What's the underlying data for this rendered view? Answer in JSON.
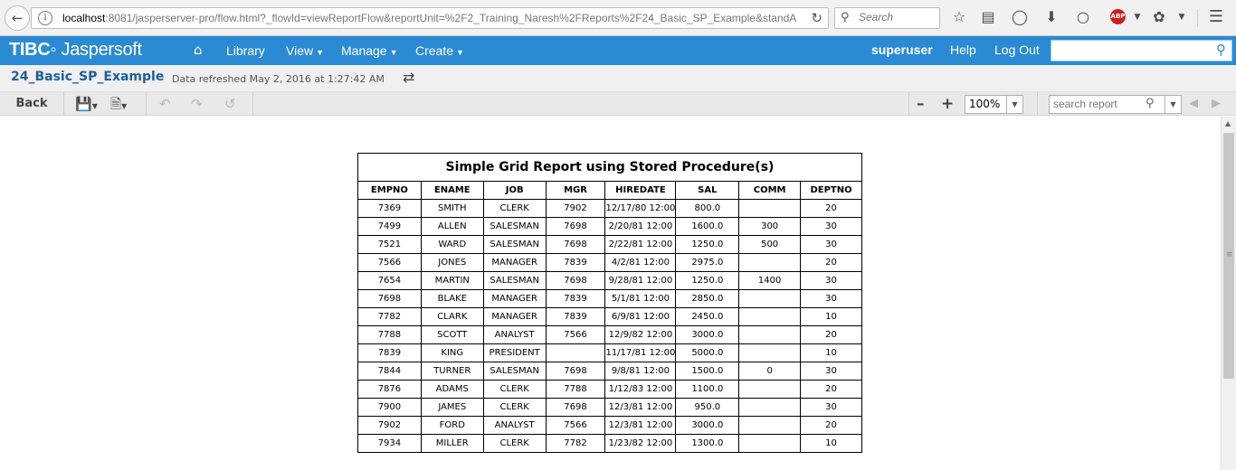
{
  "browser": {
    "url_host": "localhost",
    "url_rest": ":8081/jasperserver-pro/flow.html?_flowId=viewReportFlow&reportUnit=%2F2_Training_Naresh%2FReports%2F24_Basic_SP_Example&standA",
    "search_placeholder": "Search"
  },
  "header": {
    "logo_tibco": "TIBC",
    "logo_rest": "Jaspersoft",
    "menu": [
      {
        "label": "Library",
        "has_caret": false
      },
      {
        "label": "View",
        "has_caret": true
      },
      {
        "label": "Manage",
        "has_caret": true
      },
      {
        "label": "Create",
        "has_caret": true
      }
    ],
    "user": "superuser",
    "help": "Help",
    "logout": "Log Out",
    "search_value": ""
  },
  "title_bar": {
    "report_name": "24_Basic_SP_Example",
    "refreshed": "Data refreshed May 2, 2016 at 1:27:42 AM"
  },
  "toolbar": {
    "back": "Back",
    "zoom": "100%",
    "search_placeholder": "search report"
  },
  "report": {
    "title": "Simple Grid Report using Stored Procedure(s)",
    "columns": [
      "EMPNO",
      "ENAME",
      "JOB",
      "MGR",
      "HIREDATE",
      "SAL",
      "COMM",
      "DEPTNO"
    ],
    "rows": [
      [
        "7369",
        "SMITH",
        "CLERK",
        "7902",
        "12/17/80 12:00",
        "800.0",
        "",
        "20"
      ],
      [
        "7499",
        "ALLEN",
        "SALESMAN",
        "7698",
        "2/20/81 12:00",
        "1600.0",
        "300",
        "30"
      ],
      [
        "7521",
        "WARD",
        "SALESMAN",
        "7698",
        "2/22/81 12:00",
        "1250.0",
        "500",
        "30"
      ],
      [
        "7566",
        "JONES",
        "MANAGER",
        "7839",
        "4/2/81 12:00",
        "2975.0",
        "",
        "20"
      ],
      [
        "7654",
        "MARTIN",
        "SALESMAN",
        "7698",
        "9/28/81 12:00",
        "1250.0",
        "1400",
        "30"
      ],
      [
        "7698",
        "BLAKE",
        "MANAGER",
        "7839",
        "5/1/81 12:00",
        "2850.0",
        "",
        "30"
      ],
      [
        "7782",
        "CLARK",
        "MANAGER",
        "7839",
        "6/9/81 12:00",
        "2450.0",
        "",
        "10"
      ],
      [
        "7788",
        "SCOTT",
        "ANALYST",
        "7566",
        "12/9/82 12:00",
        "3000.0",
        "",
        "20"
      ],
      [
        "7839",
        "KING",
        "PRESIDENT",
        "",
        "11/17/81 12:00",
        "5000.0",
        "",
        "10"
      ],
      [
        "7844",
        "TURNER",
        "SALESMAN",
        "7698",
        "9/8/81 12:00",
        "1500.0",
        "0",
        "30"
      ],
      [
        "7876",
        "ADAMS",
        "CLERK",
        "7788",
        "1/12/83 12:00",
        "1100.0",
        "",
        "20"
      ],
      [
        "7900",
        "JAMES",
        "CLERK",
        "7698",
        "12/3/81 12:00",
        "950.0",
        "",
        "30"
      ],
      [
        "7902",
        "FORD",
        "ANALYST",
        "7566",
        "12/3/81 12:00",
        "3000.0",
        "",
        "20"
      ],
      [
        "7934",
        "MILLER",
        "CLERK",
        "7782",
        "1/23/82 12:00",
        "1300.0",
        "",
        "10"
      ]
    ]
  },
  "colors": {
    "header_blue": "#2a8ad4",
    "title_blue": "#1f5f97"
  }
}
